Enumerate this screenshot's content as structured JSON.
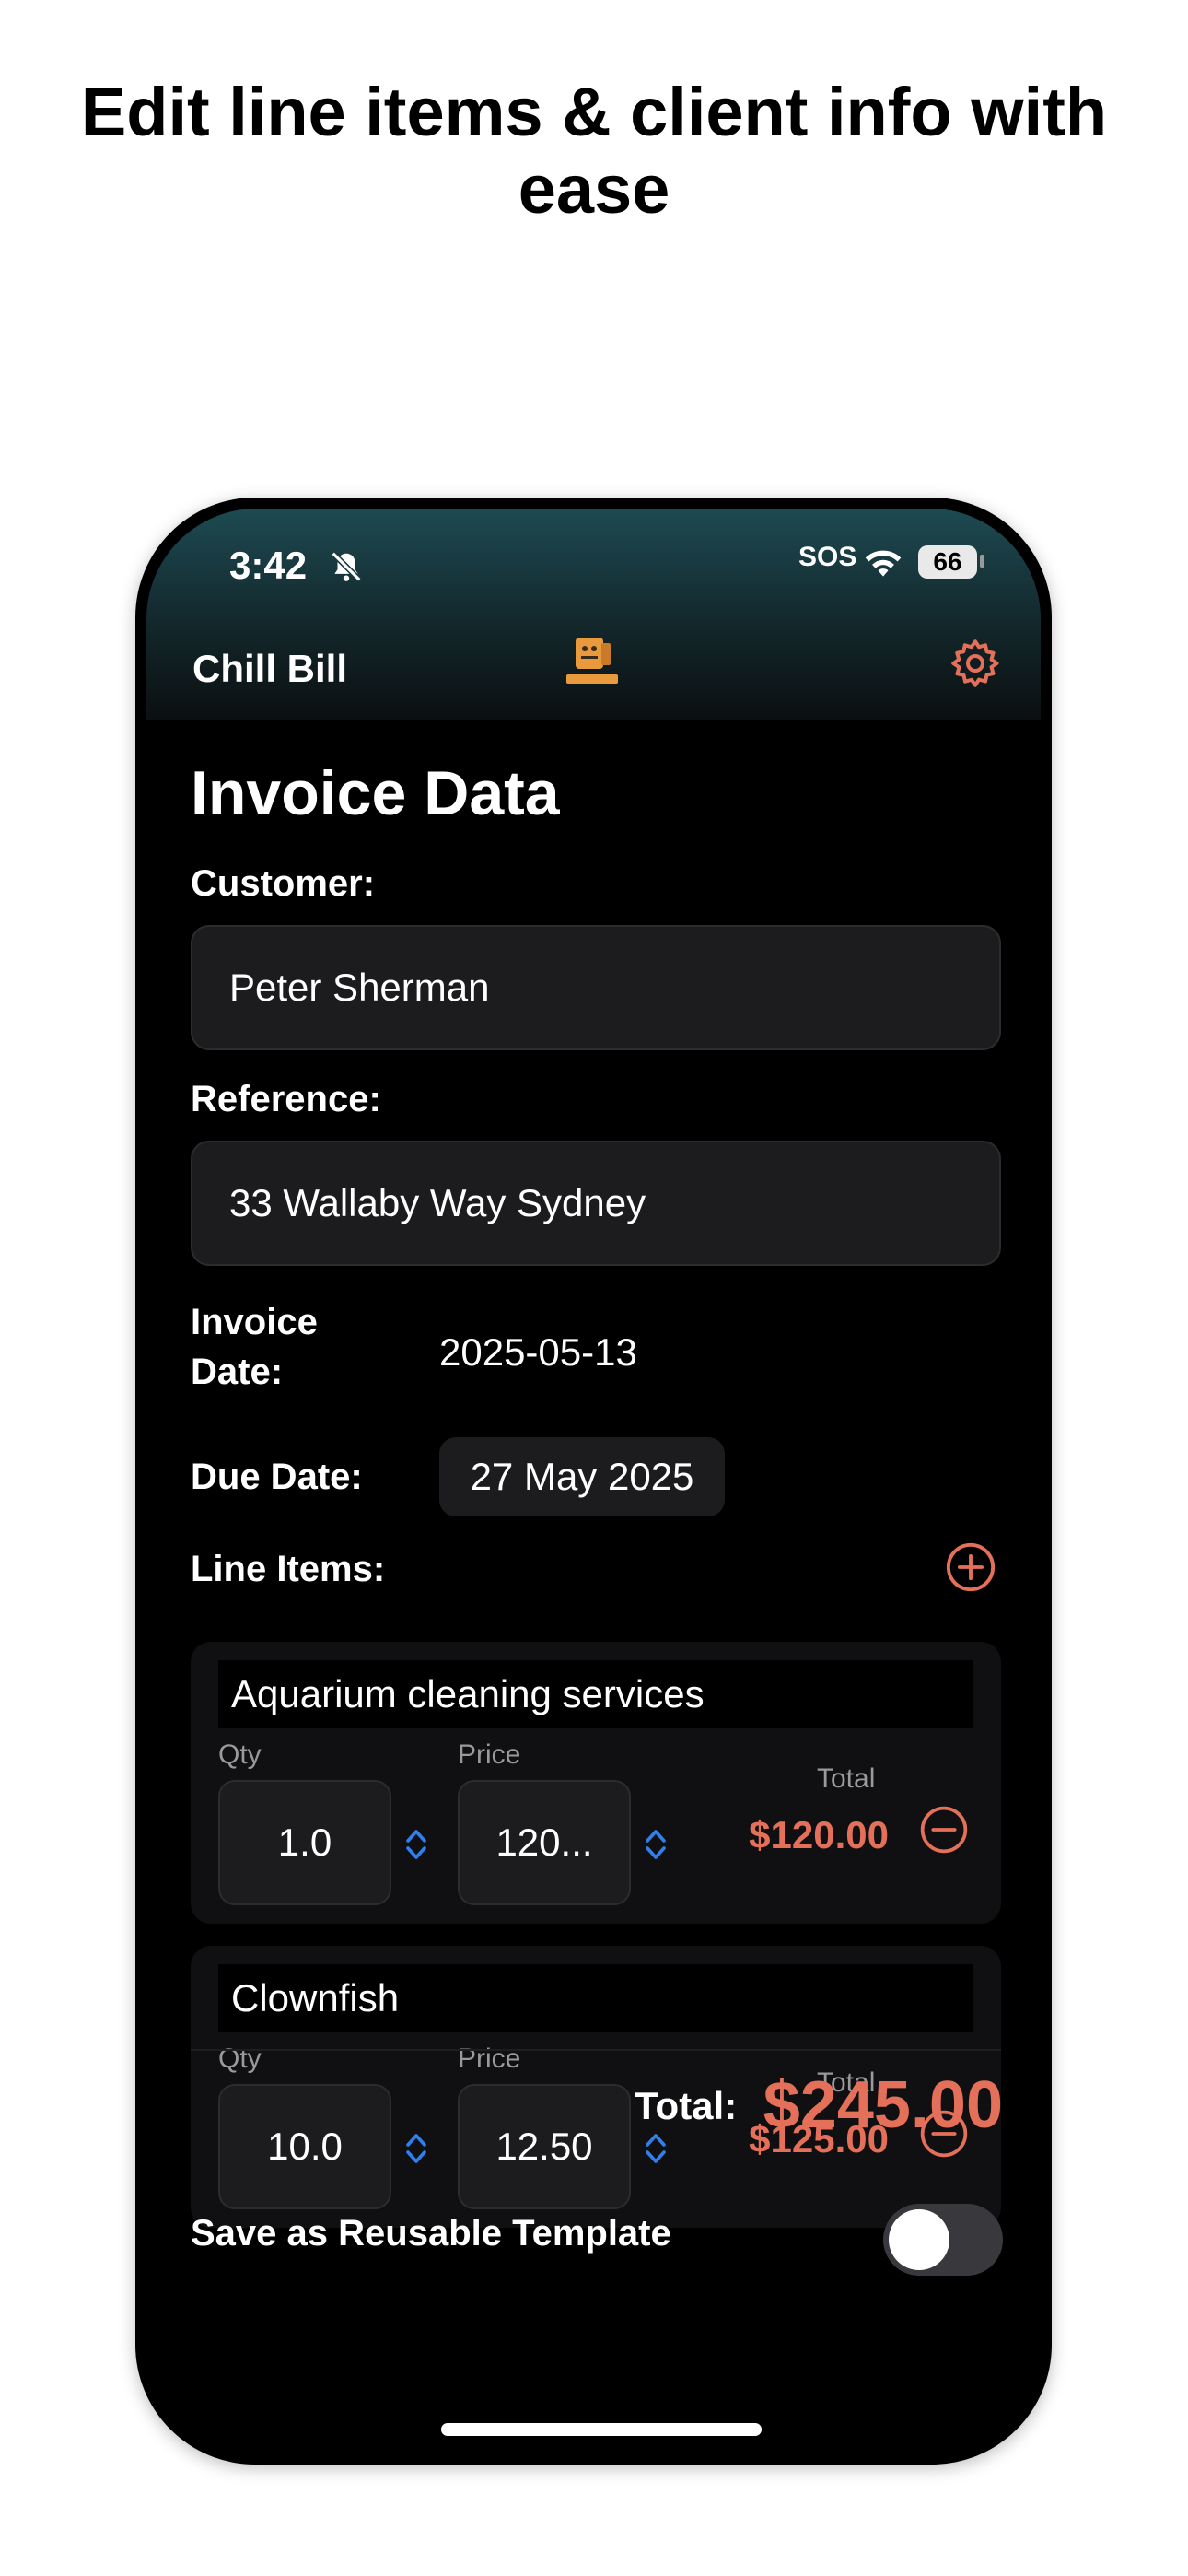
{
  "headline": "Edit line items & client info with ease",
  "status_bar": {
    "time": "3:42",
    "sos": "SOS",
    "battery": "66"
  },
  "app": {
    "title": "Chill Bill",
    "logo_icon": "chill-bill-logo",
    "settings_icon": "gear-icon"
  },
  "page_title": "Invoice Data",
  "customer": {
    "label": "Customer:",
    "value": "Peter Sherman"
  },
  "reference": {
    "label": "Reference:",
    "value": "33 Wallaby Way Sydney"
  },
  "invoice_date": {
    "label": "Invoice Date:",
    "value": "2025-05-13"
  },
  "due_date": {
    "label": "Due Date:",
    "value": "27 May 2025"
  },
  "line_items": {
    "label": "Line Items:",
    "qty_label": "Qty",
    "price_label": "Price",
    "total_label": "Total",
    "items": [
      {
        "name": "Aquarium cleaning services",
        "qty": "1.0",
        "price": "120...",
        "total": "$120.00"
      },
      {
        "name": "Clownfish",
        "qty": "10.0",
        "price": "12.50",
        "total": "$125.00"
      }
    ]
  },
  "total": {
    "label": "Total:",
    "value": "$245.00"
  },
  "template": {
    "label": "Save as Reusable Template",
    "enabled": false
  },
  "colors": {
    "accent": "#e5705a",
    "stepper": "#2f80ed",
    "background": "#000000",
    "field": "#1c1c1e"
  }
}
